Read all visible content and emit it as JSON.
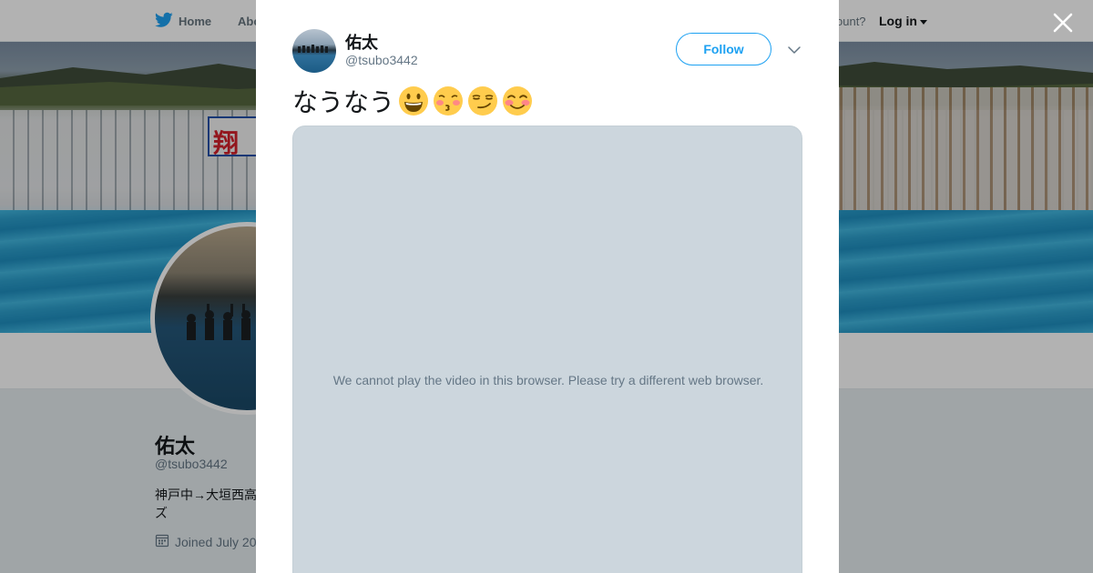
{
  "topnav": {
    "home_label": "Home",
    "about_label": "Abo",
    "account_prompt": "ccount?",
    "login_label": "Log in"
  },
  "profile": {
    "name": "佑太",
    "handle": "@tsubo3442",
    "bio": "神戸中→大垣西高ズ",
    "joined": "Joined July 20"
  },
  "banner": {
    "flag_text": "翔"
  },
  "tweet": {
    "author_name": "佑太",
    "author_handle": "@tsubo3442",
    "follow_label": "Follow",
    "text": "なうなう",
    "emojis": [
      "grinning-face",
      "kissing-face-closed-eyes",
      "smirking-face",
      "smiling-face-blushing"
    ],
    "video_message": "We cannot play the video in this browser. Please try a different web browser."
  },
  "colors": {
    "accent": "#1da1f2",
    "text_primary": "#14171a",
    "text_secondary": "#657786",
    "video_placeholder": "#ccd6dd"
  },
  "icons": {
    "brand": "twitter-bird-icon",
    "close": "close-icon",
    "more": "chevron-down-icon",
    "calendar": "calendar-icon"
  }
}
